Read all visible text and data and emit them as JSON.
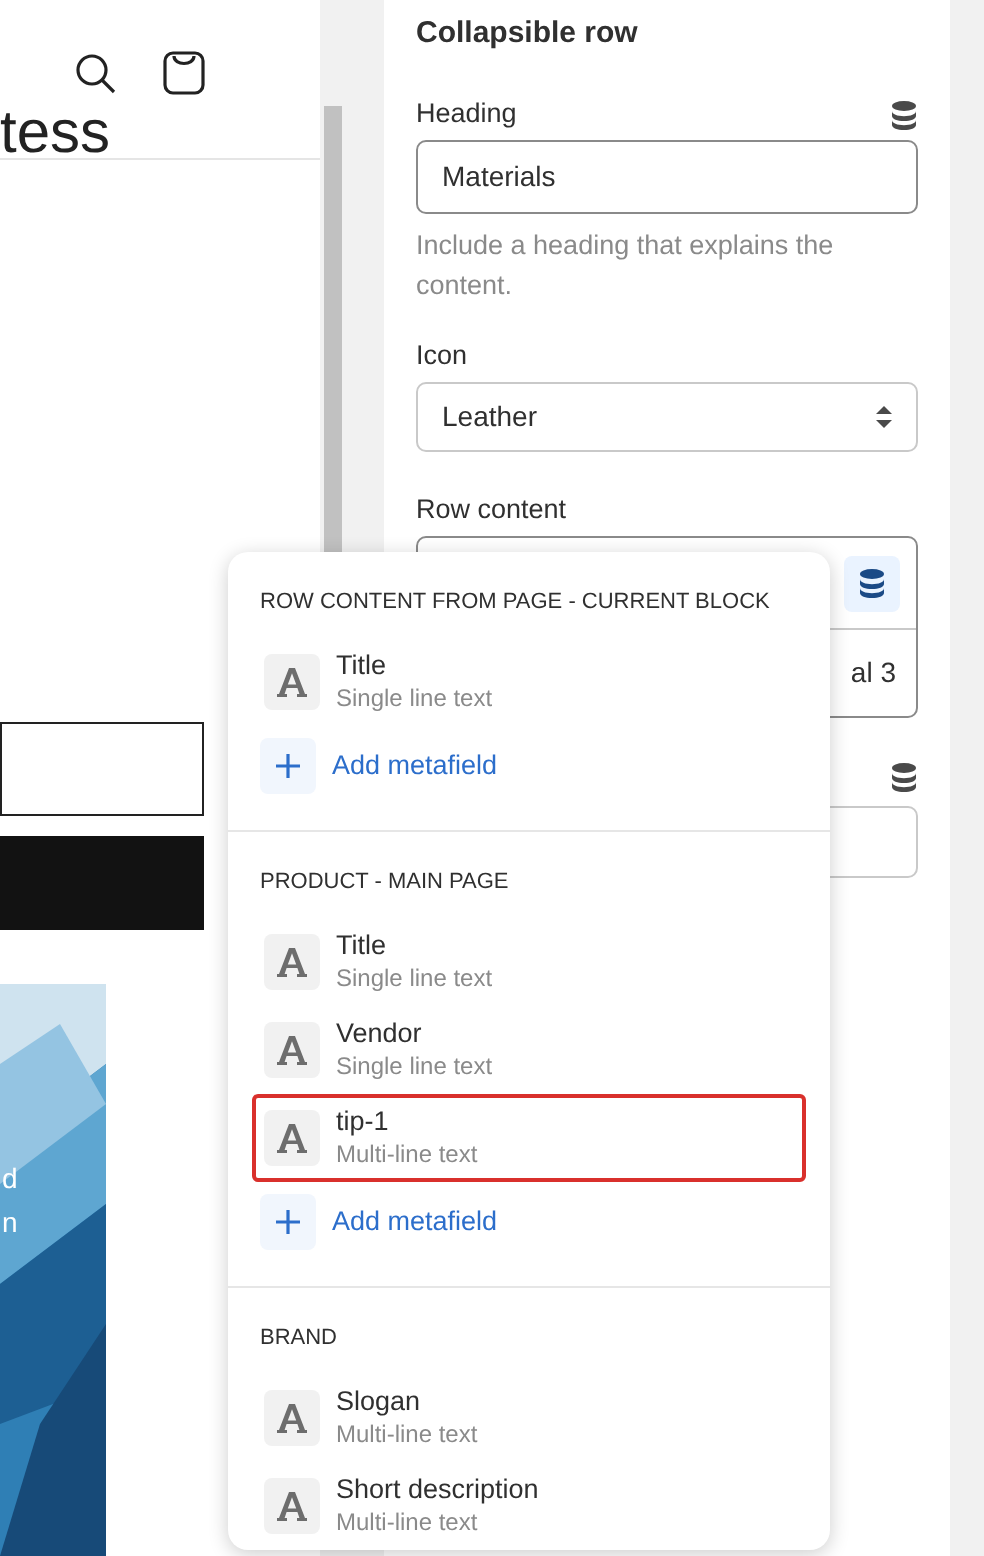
{
  "preview": {
    "heading_fragment": "tess",
    "banner_text": [
      "d",
      "n"
    ]
  },
  "settings": {
    "title": "Collapsible row",
    "heading": {
      "label": "Heading",
      "value": "Materials",
      "help": "Include a heading that explains the content."
    },
    "icon": {
      "label": "Icon",
      "value": "Leather"
    },
    "row_content": {
      "label": "Row content",
      "value": "al 3"
    }
  },
  "popover": {
    "sections": [
      {
        "title": "ROW CONTENT FROM PAGE - CURRENT BLOCK",
        "items": [
          {
            "name": "Title",
            "type": "Single line text",
            "highlighted": false
          }
        ],
        "add_label": "Add metafield"
      },
      {
        "title": "PRODUCT - MAIN PAGE",
        "items": [
          {
            "name": "Title",
            "type": "Single line text",
            "highlighted": false
          },
          {
            "name": "Vendor",
            "type": "Single line text",
            "highlighted": false
          },
          {
            "name": "tip-1",
            "type": "Multi-line text",
            "highlighted": true
          }
        ],
        "add_label": "Add metafield"
      },
      {
        "title": "BRAND",
        "items": [
          {
            "name": "Slogan",
            "type": "Multi-line text",
            "highlighted": false
          },
          {
            "name": "Short description",
            "type": "Multi-line text",
            "highlighted": false
          }
        ]
      }
    ]
  }
}
